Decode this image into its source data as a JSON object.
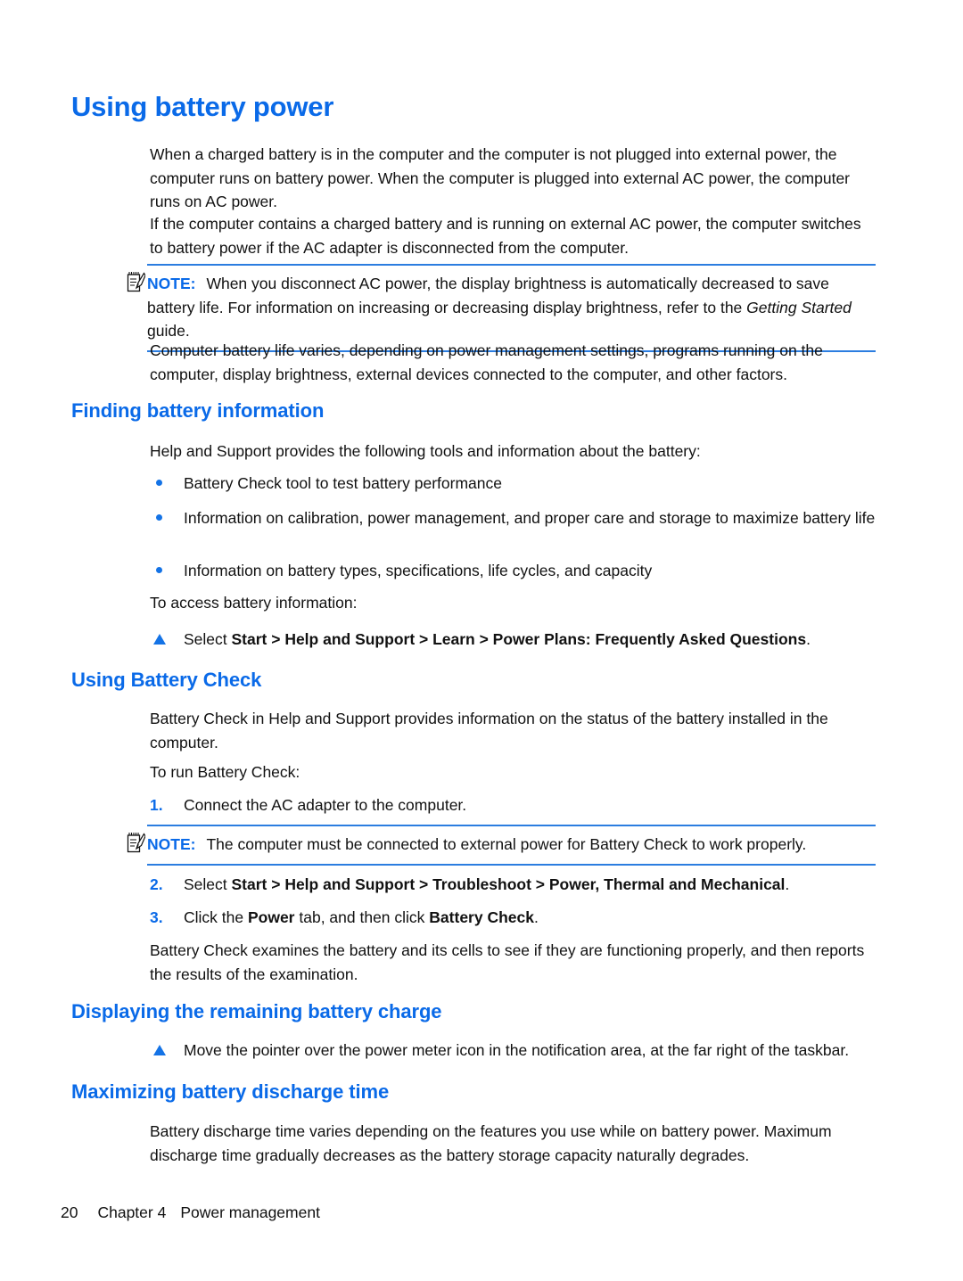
{
  "colors": {
    "heading_blue": "#0a6ae8",
    "marker_blue": "#1473e6",
    "rule_blue": "#2b7de0",
    "body_black": "#111111"
  },
  "page": {
    "title": "Using battery power"
  },
  "intro": {
    "paragraph_1": "When a charged battery is in the computer and the computer is not plugged into external power, the computer runs on battery power. When the computer is plugged into external AC power, the computer runs on AC power.",
    "paragraph_2": "If the computer contains a charged battery and is running on external AC power, the computer switches to battery power if the AC adapter is disconnected from the computer.",
    "paragraph_3": "Computer battery life varies, depending on power management settings, programs running on the computer, display brightness, external devices connected to the computer, and other factors."
  },
  "note_1": {
    "icon": "note-pad-pencil-icon",
    "label": "NOTE:",
    "text_part_1": "When you disconnect AC power, the display brightness is automatically decreased to save battery life. For information on increasing or decreasing display brightness, refer to the ",
    "italic_part": "Getting Started",
    "text_part_2": " guide."
  },
  "section_finding": {
    "heading": "Finding battery information",
    "lead_in": "Help and Support provides the following tools and information about the battery:",
    "bullets": [
      "Battery Check tool to test battery performance",
      "Information on calibration, power management, and proper care and storage to maximize battery life",
      "Information on battery types, specifications, life cycles, and capacity"
    ],
    "access_lead_in": "To access battery information:",
    "step": {
      "marker": "triangle-bullet",
      "prefix": "Select ",
      "bold": "Start > Help and Support > Learn > Power Plans: Frequently Asked Questions",
      "suffix": "."
    }
  },
  "section_battery_check": {
    "heading": "Using Battery Check",
    "paragraph": "Battery Check in Help and Support provides information on the status of the battery installed in the computer.",
    "lead_in": "To run Battery Check:",
    "steps": [
      {
        "number": "1.",
        "prefix": "Connect the AC adapter to the computer.",
        "bold": "",
        "suffix": ""
      },
      {
        "number": "2.",
        "prefix": "Select ",
        "bold": "Start > Help and Support > Troubleshoot > Power, Thermal and Mechanical",
        "suffix": "."
      },
      {
        "number": "3.",
        "prefix": "Click the ",
        "bold": "Power",
        "mid": " tab, and then click ",
        "bold_2": "Battery Check",
        "suffix": "."
      }
    ],
    "note_2": {
      "icon": "note-pad-pencil-icon",
      "label": "NOTE:",
      "text": "The computer must be connected to external power for Battery Check to work properly."
    },
    "closing_paragraph": "Battery Check examines the battery and its cells to see if they are functioning properly, and then reports the results of the examination."
  },
  "section_displaying": {
    "heading": "Displaying the remaining battery charge",
    "step": {
      "marker": "triangle-bullet",
      "text": "Move the pointer over the power meter icon in the notification area, at the far right of the taskbar."
    }
  },
  "section_maximizing": {
    "heading": "Maximizing battery discharge time",
    "paragraph": "Battery discharge time varies depending on the features you use while on battery power. Maximum discharge time gradually decreases as the battery storage capacity naturally degrades."
  },
  "footer": {
    "page_number": "20",
    "chapter": "Chapter 4",
    "chapter_title": "Power management"
  }
}
